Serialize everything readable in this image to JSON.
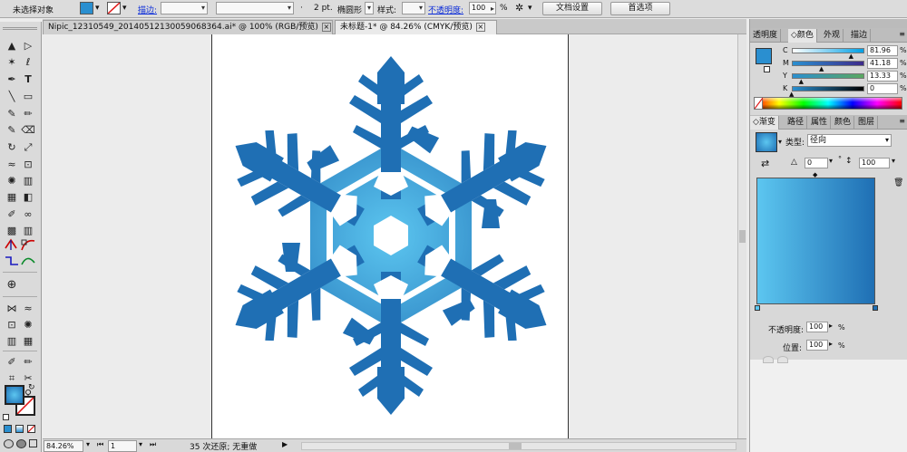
{
  "control_bar": {
    "selection_label": "未选择对象",
    "stroke_link": "描边:",
    "stroke_size": "2 pt.",
    "brush_shape": "椭圆形",
    "style_label": "样式:",
    "opacity_link": "不透明度:",
    "opacity_value": "100",
    "opacity_unit": "%",
    "doc_setup_button": "文档设置",
    "preferences_button": "首选项"
  },
  "tabs": [
    {
      "label": "Nipic_12310549_20140512130059068364.ai* @ 100% (RGB/预览)",
      "close": "×"
    },
    {
      "label": "未标题-1* @ 84.26% (CMYK/预览)",
      "close": "×"
    }
  ],
  "status_bar": {
    "zoom": "84.26%",
    "page": "1",
    "message": "35 次还原; 无重做",
    "play_arrow": "▶"
  },
  "color_panel": {
    "tabs": [
      "透明度",
      "◇颜色",
      "外观",
      "描边"
    ],
    "channels": [
      {
        "label": "C",
        "value": "81.96",
        "fraction": 0.8196
      },
      {
        "label": "M",
        "value": "41.18",
        "fraction": 0.4118
      },
      {
        "label": "Y",
        "value": "13.33",
        "fraction": 0.1333
      },
      {
        "label": "K",
        "value": "0",
        "fraction": 0
      }
    ],
    "percent": "%"
  },
  "gradient_panel": {
    "tabs": [
      "◇渐变",
      "路径",
      "属性",
      "颜色",
      "图层"
    ],
    "type_label": "类型:",
    "type_value": "径向",
    "angle_value": "0",
    "degree": "°",
    "aspect_value": "100",
    "aspect_unit": "%",
    "opacity_label": "不透明度:",
    "opacity_value": "100",
    "position_label": "位置:",
    "position_value": "100",
    "percent": "%"
  },
  "colors": {
    "accent_blue": "#2a8fd0",
    "artwork_blue_dark": "#1f6fb4",
    "artwork_blue_light": "#5cc6f0"
  },
  "icons": {
    "selection": "▲",
    "direct_selection": "▷",
    "magic_wand": "✶",
    "lasso": "ℓ",
    "pen": "✒",
    "type": "T",
    "line": "╲",
    "rect": "▭",
    "brush": "✎",
    "pencil": "✏",
    "eraser": "⌫",
    "rotate": "↻",
    "scale": "⤢",
    "warp": "≈",
    "free_transform": "⊡",
    "symbol_sprayer": "✺",
    "graph": "▥",
    "mesh": "▦",
    "gradient_tool": "◧",
    "eyedropper": "✐",
    "blend": "∞",
    "live_paint": "▩",
    "crop": "⌗",
    "slice": "✂",
    "perspective": "⊕",
    "width": "⋈",
    "hand": "✋",
    "zoom_tool": "⚲"
  }
}
